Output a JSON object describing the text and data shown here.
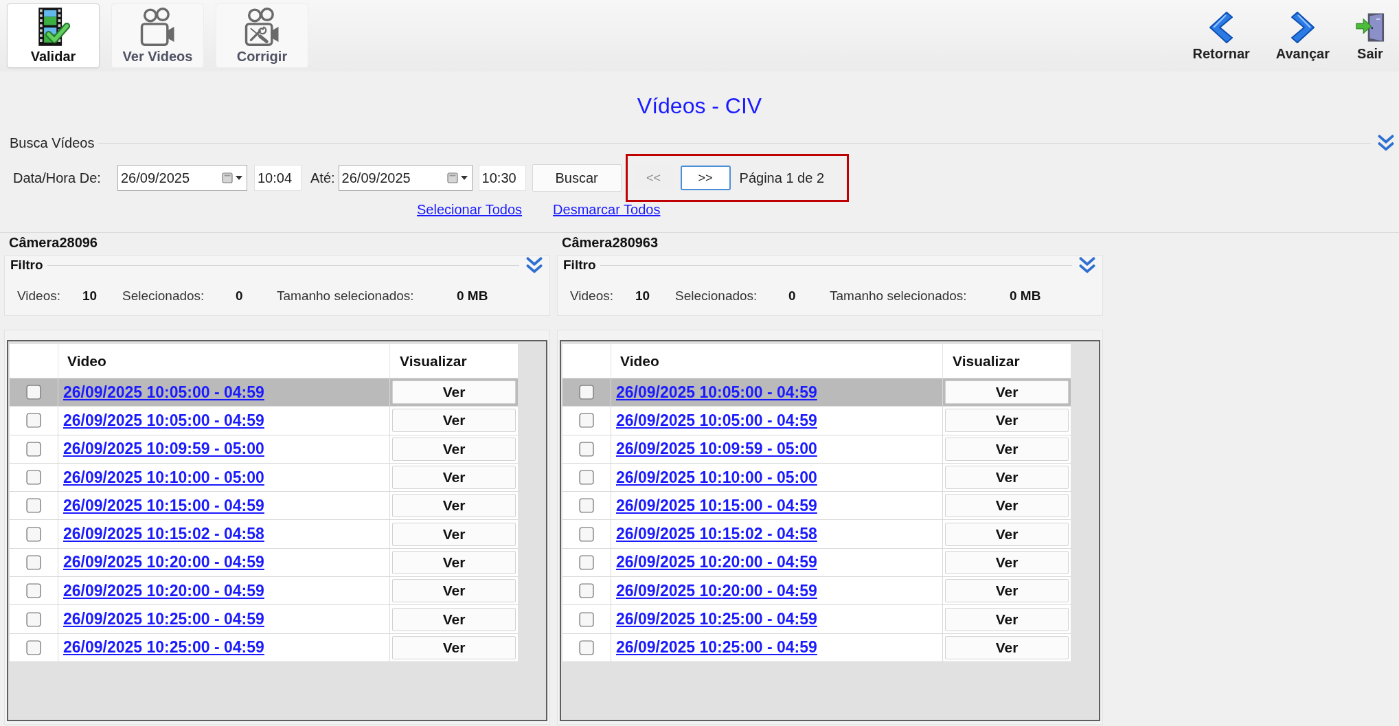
{
  "toolbar": {
    "left": [
      {
        "kind": "validate",
        "label": "Validar",
        "selected": true
      },
      {
        "kind": "camera",
        "label": "Ver Videos",
        "selected": false
      },
      {
        "kind": "camera-tools",
        "label": "Corrigir",
        "selected": false
      }
    ],
    "right": [
      {
        "kind": "back",
        "label": "Retornar"
      },
      {
        "kind": "forward",
        "label": "Avançar"
      },
      {
        "kind": "exit",
        "label": "Sair"
      }
    ]
  },
  "title": "Vídeos - CIV",
  "search": {
    "title": "Busca Vídeos",
    "from_label": "Data/Hora De:",
    "from_date": "26/09/2025",
    "from_time": "10:04",
    "to_label": "Até:",
    "to_date": "26/09/2025",
    "to_time": "10:30",
    "search_button": "Buscar",
    "pager": {
      "highlighted": true,
      "buttons": [
        {
          "label": "<<",
          "disabled": true,
          "focused": false
        },
        {
          "label": ">>",
          "disabled": false,
          "focused": true
        }
      ],
      "page_text": "Página 1 de 2"
    },
    "links": [
      "Selecionar Todos",
      "Desmarcar Todos"
    ]
  },
  "cameras": [
    {
      "name": "Câmera28096",
      "filter": {
        "title": "Filtro",
        "stats": [
          {
            "label": "Videos:",
            "value": "10"
          },
          {
            "label": "Selecionados:",
            "value": "0"
          },
          {
            "label": "Tamanho selecionados:",
            "value": "0 MB"
          }
        ]
      },
      "table": {
        "columns": [
          "Video",
          "Visualizar"
        ],
        "rows": [
          {
            "video": "26/09/2025 10:05:00 - 04:59",
            "action": "Ver",
            "checked": false,
            "selected": true
          },
          {
            "video": "26/09/2025 10:05:00 - 04:59",
            "action": "Ver",
            "checked": false,
            "selected": false
          },
          {
            "video": "26/09/2025 10:09:59 - 05:00",
            "action": "Ver",
            "checked": false,
            "selected": false
          },
          {
            "video": "26/09/2025 10:10:00 - 05:00",
            "action": "Ver",
            "checked": false,
            "selected": false
          },
          {
            "video": "26/09/2025 10:15:00 - 04:59",
            "action": "Ver",
            "checked": false,
            "selected": false
          },
          {
            "video": "26/09/2025 10:15:02 - 04:58",
            "action": "Ver",
            "checked": false,
            "selected": false
          },
          {
            "video": "26/09/2025 10:20:00 - 04:59",
            "action": "Ver",
            "checked": false,
            "selected": false
          },
          {
            "video": "26/09/2025 10:20:00 - 04:59",
            "action": "Ver",
            "checked": false,
            "selected": false
          },
          {
            "video": "26/09/2025 10:25:00 - 04:59",
            "action": "Ver",
            "checked": false,
            "selected": false
          },
          {
            "video": "26/09/2025 10:25:00 - 04:59",
            "action": "Ver",
            "checked": false,
            "selected": false
          }
        ]
      }
    },
    {
      "name": "Câmera280963",
      "filter": {
        "title": "Filtro",
        "stats": [
          {
            "label": "Videos:",
            "value": "10"
          },
          {
            "label": "Selecionados:",
            "value": "0"
          },
          {
            "label": "Tamanho selecionados:",
            "value": "0 MB"
          }
        ]
      },
      "table": {
        "columns": [
          "Video",
          "Visualizar"
        ],
        "rows": [
          {
            "video": "26/09/2025 10:05:00 - 04:59",
            "action": "Ver",
            "checked": false,
            "selected": true
          },
          {
            "video": "26/09/2025 10:05:00 - 04:59",
            "action": "Ver",
            "checked": false,
            "selected": false
          },
          {
            "video": "26/09/2025 10:09:59 - 05:00",
            "action": "Ver",
            "checked": false,
            "selected": false
          },
          {
            "video": "26/09/2025 10:10:00 - 05:00",
            "action": "Ver",
            "checked": false,
            "selected": false
          },
          {
            "video": "26/09/2025 10:15:00 - 04:59",
            "action": "Ver",
            "checked": false,
            "selected": false
          },
          {
            "video": "26/09/2025 10:15:02 - 04:58",
            "action": "Ver",
            "checked": false,
            "selected": false
          },
          {
            "video": "26/09/2025 10:20:00 - 04:59",
            "action": "Ver",
            "checked": false,
            "selected": false
          },
          {
            "video": "26/09/2025 10:20:00 - 04:59",
            "action": "Ver",
            "checked": false,
            "selected": false
          },
          {
            "video": "26/09/2025 10:25:00 - 04:59",
            "action": "Ver",
            "checked": false,
            "selected": false
          },
          {
            "video": "26/09/2025 10:25:00 - 04:59",
            "action": "Ver",
            "checked": false,
            "selected": false
          }
        ]
      }
    }
  ]
}
